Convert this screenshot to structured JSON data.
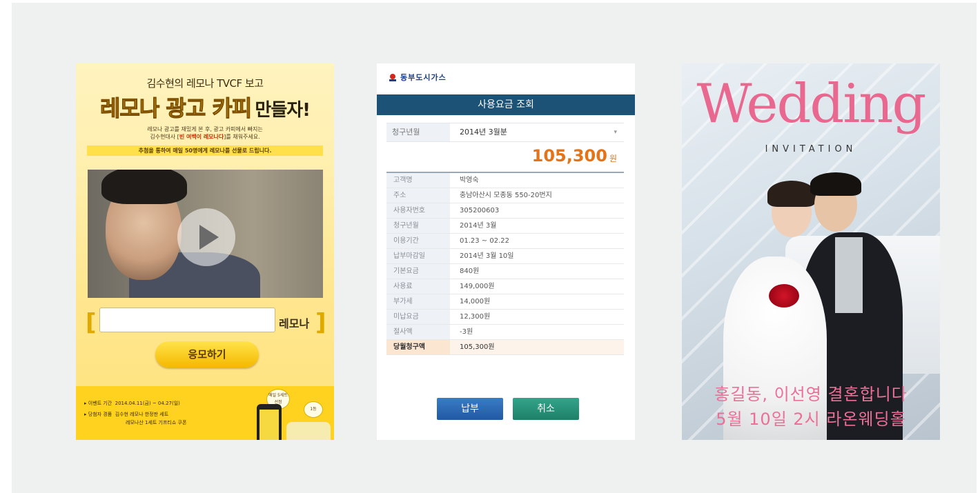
{
  "promo": {
    "headline": "김수현의 레모나 TVCF 보고",
    "big_title": "레모나 광고 카피",
    "big_title_suffix": "만들자!",
    "desc_line1": "레모나 광고를 재밌게 본 후, 광고 카피에서 빠지는",
    "desc_line2_a": "김수현대사 [",
    "desc_line2_highlight": "빈 여백이 레모나다",
    "desc_line2_b": "]를 채워주세요.",
    "prize_text": "추첨을 통하여 매일 50명에게 레모나를 선물로 드립니다.",
    "input_suffix": "레모나",
    "bracket_left": "[",
    "bracket_right": "]",
    "enter_button": "응모하기",
    "event_period_label": "이벤트 기간",
    "event_period": "2014.04.11(금) ~ 04.27(일)",
    "winner_label": "당첨자 경품",
    "winner_line1": "김수현 레모나 한정판 세트",
    "winner_line2": "레모나산 1세트 기프티쇼 쿠폰",
    "bubble1": "매일 5세트 선정",
    "bubble2": "1등"
  },
  "gas": {
    "brand": "동부도시가스",
    "title": "사용요금 조회",
    "picker_label": "청구년월",
    "picker_value": "2014년 3월분",
    "amount": "105,300",
    "amount_unit": "원",
    "rows": [
      {
        "k": "고객명",
        "v": "박영숙"
      },
      {
        "k": "주소",
        "v": "충남아산시 모종동 550-20번지"
      },
      {
        "k": "사용자번호",
        "v": "305200603"
      },
      {
        "k": "청구년월",
        "v": "2014년 3월"
      },
      {
        "k": "이용기간",
        "v": "01.23 ~ 02.22"
      },
      {
        "k": "납부마감일",
        "v": "2014년 3월 10일"
      },
      {
        "k": "기본요금",
        "v": "840원"
      },
      {
        "k": "사용료",
        "v": "149,000원"
      },
      {
        "k": "부가세",
        "v": "14,000원"
      },
      {
        "k": "미납요금",
        "v": "12,300원"
      },
      {
        "k": "절사액",
        "v": "-3원"
      },
      {
        "k": "당월청구액",
        "v": "105,300원"
      }
    ],
    "pay_button": "납부",
    "cancel_button": "취소"
  },
  "wedding": {
    "title": "Wedding",
    "subtitle": "INVITATION",
    "line1": "홍길동, 이선영 결혼합니다",
    "line2": "5월 10일 2시 라온웨딩홀"
  },
  "colors": {
    "gas_header": "#1b5275",
    "gas_amount": "#e47417",
    "wedding_pink": "#e8688f",
    "promo_yellow": "#ffd21f"
  }
}
